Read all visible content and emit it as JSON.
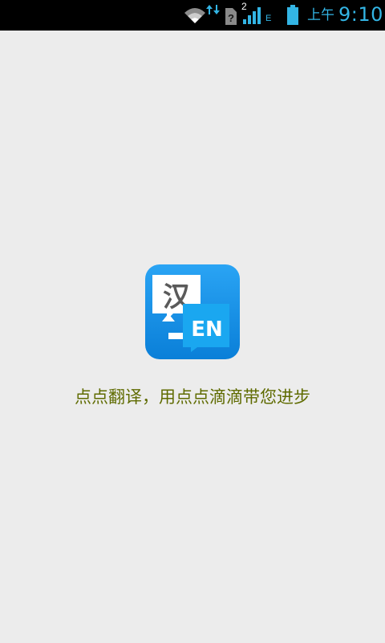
{
  "status_bar": {
    "time_prefix": "上午",
    "time": "9:10",
    "sim_slot": "2",
    "network_type": "E",
    "icons": [
      "wifi-icon",
      "data-activity-icon",
      "no-sim-icon",
      "signal-icon",
      "battery-icon"
    ],
    "accent_color": "#33b5e5"
  },
  "splash": {
    "logo": {
      "source_char": "汉",
      "target_text": "EN",
      "icon": "translate-app-logo"
    },
    "tagline": "点点翻译，用点点滴滴带您进步",
    "tagline_color": "#5f6b00",
    "background_color": "#ececec"
  }
}
